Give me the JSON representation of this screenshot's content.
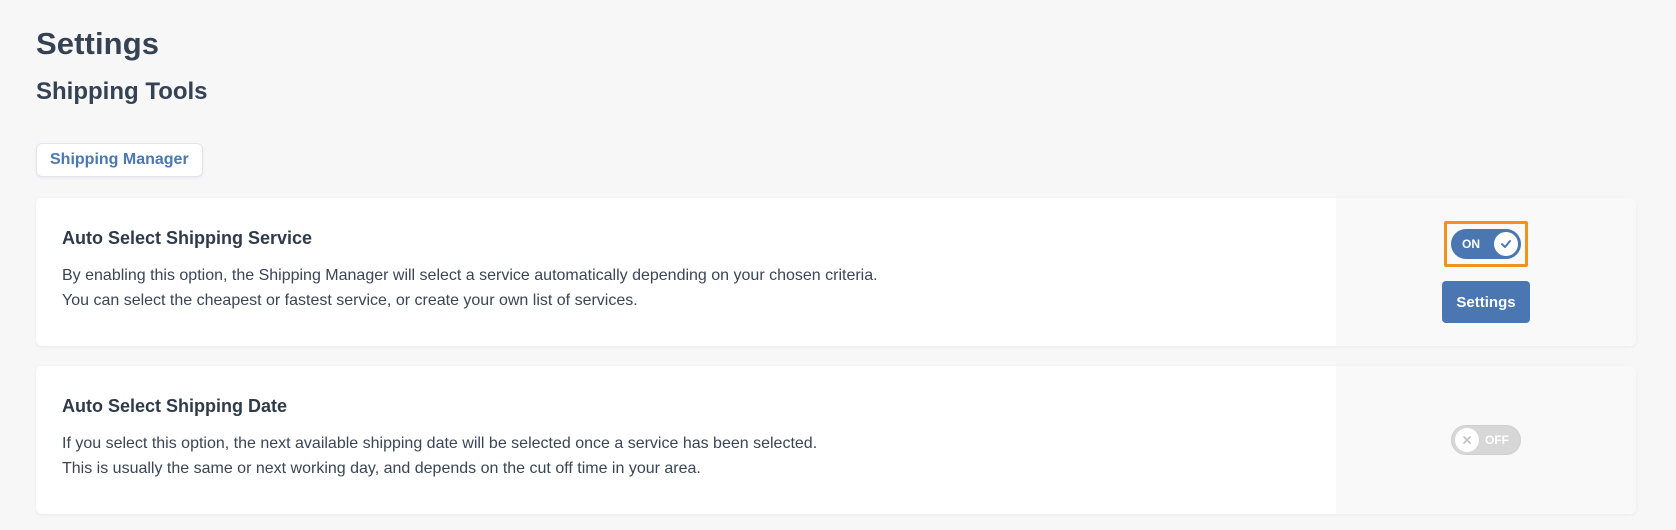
{
  "page": {
    "title": "Settings",
    "section_title": "Shipping Tools"
  },
  "tabs": [
    {
      "label": "Shipping Manager",
      "active": true
    }
  ],
  "options": [
    {
      "title": "Auto Select Shipping Service",
      "description_lines": [
        "By enabling this option, the Shipping Manager will select a service automatically depending on your chosen criteria.",
        "You can select the cheapest or fastest service, or create your own list of services."
      ],
      "toggle": {
        "state": "on",
        "label": "ON",
        "knob_icon": "check-icon"
      },
      "button_label": "Settings"
    },
    {
      "title": "Auto Select Shipping Date",
      "description_lines": [
        "If you select this option, the next available shipping date will be selected once a service has been selected.",
        "This is usually the same or next working day, and depends on the cut off time in your area."
      ],
      "toggle": {
        "state": "off",
        "label": "OFF",
        "knob_icon": "close-icon"
      }
    }
  ],
  "colors": {
    "accent": "#4a77b1",
    "focus_outline": "#f0921e",
    "toggle_off": "#d7d7d7",
    "heading": "#354254"
  }
}
